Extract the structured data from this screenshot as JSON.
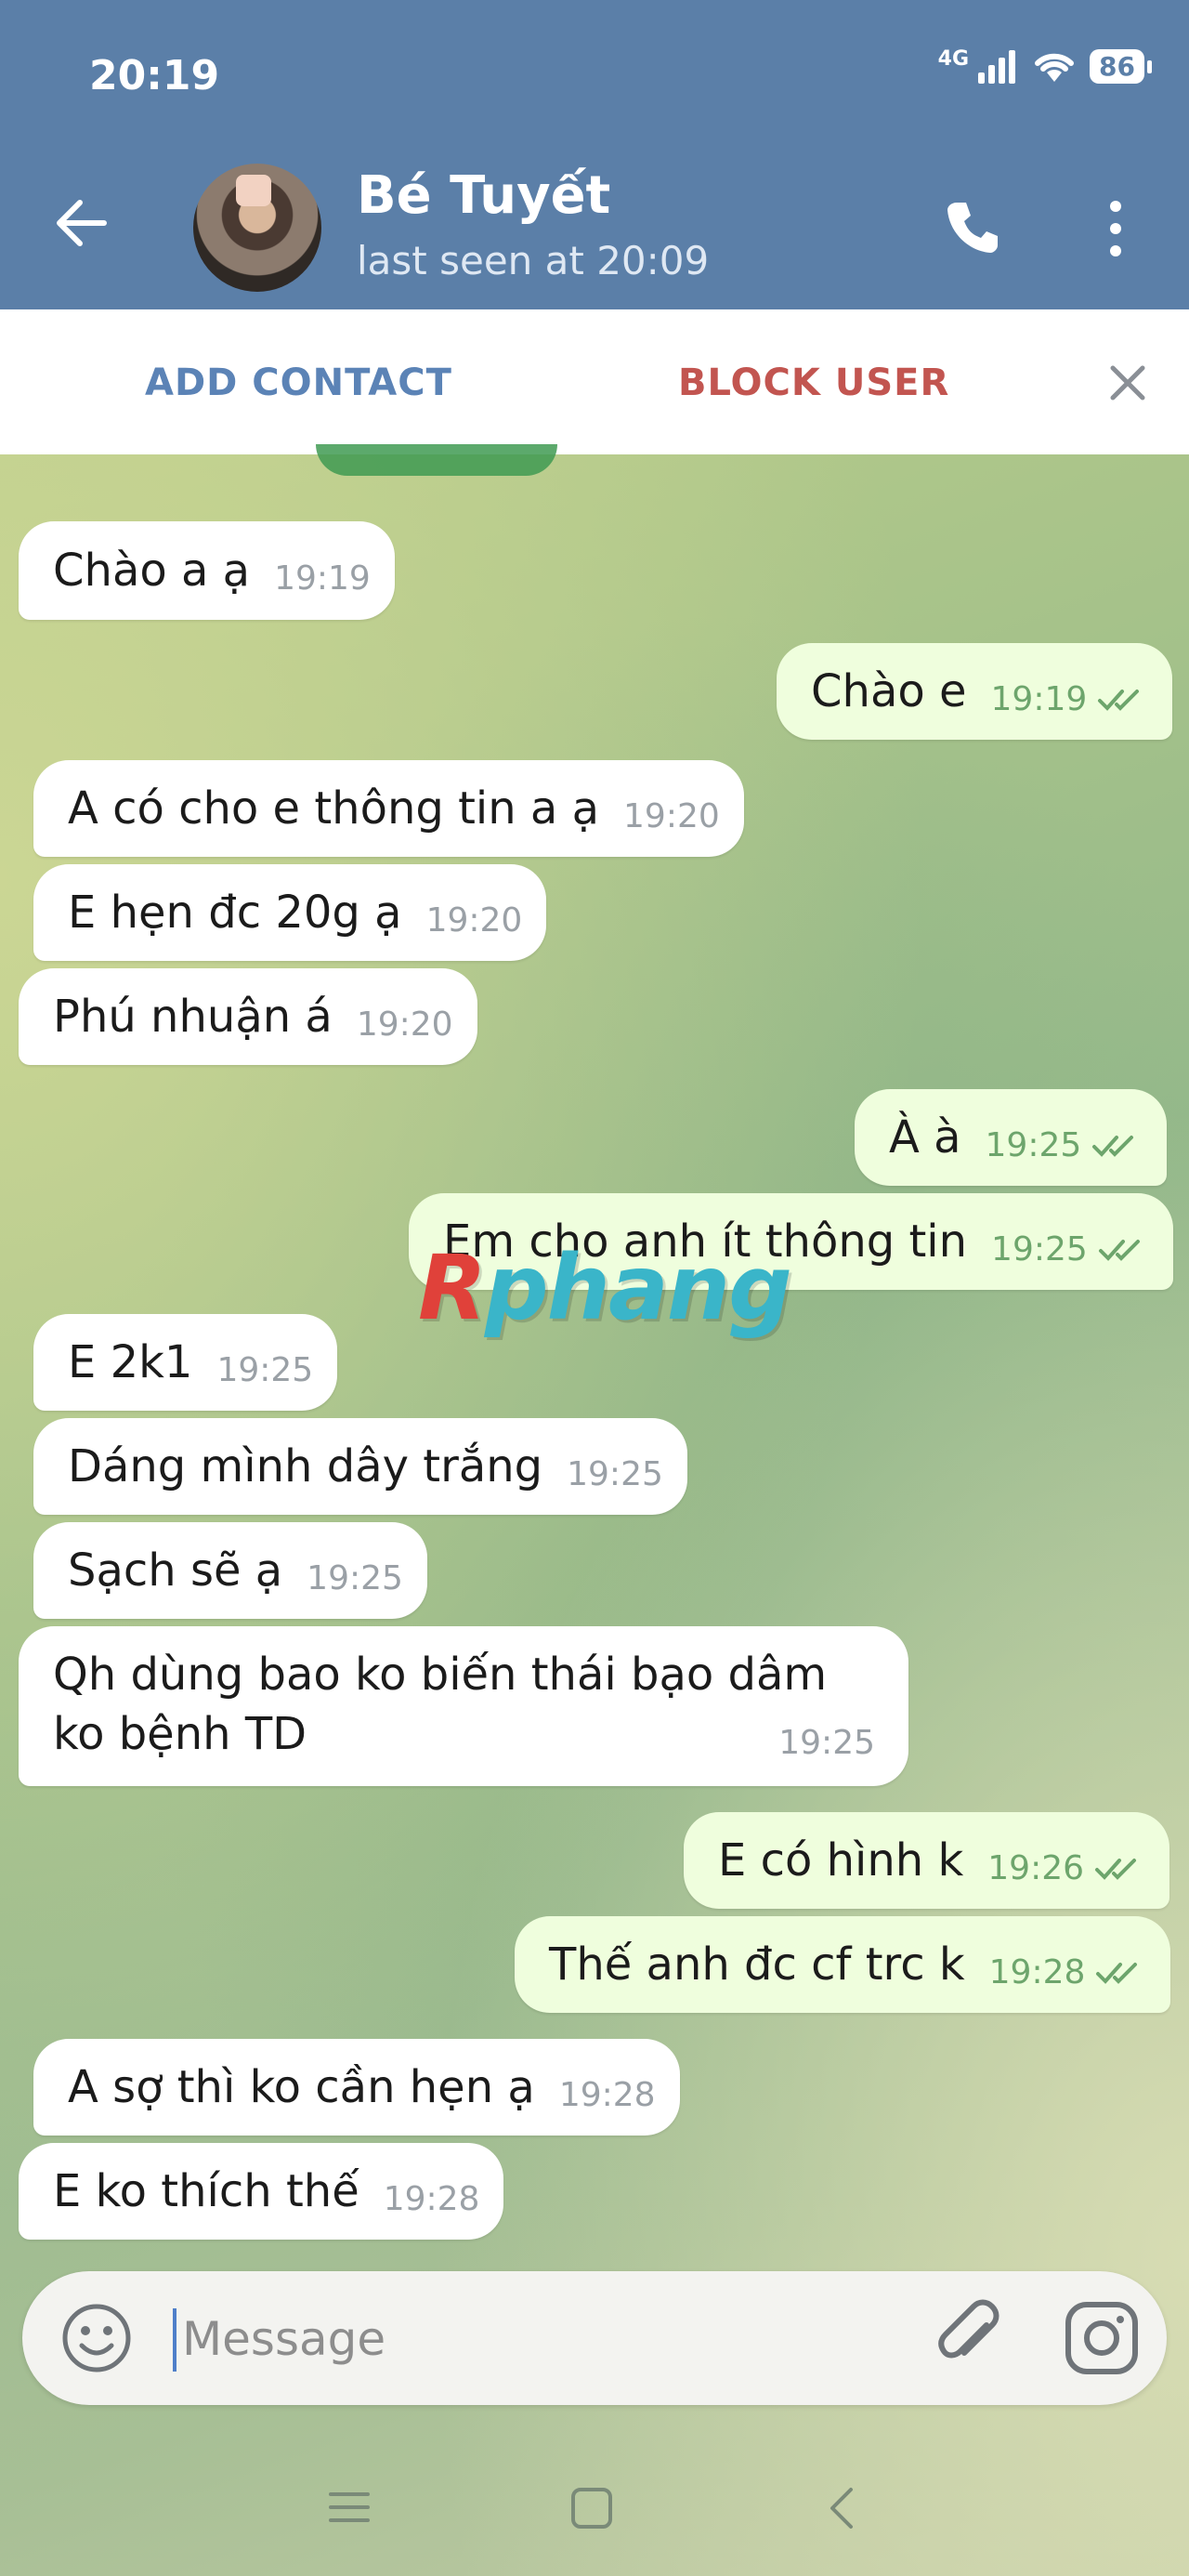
{
  "status_bar": {
    "time": "20:19",
    "network": "4G",
    "battery": "86"
  },
  "header": {
    "contact_name": "Bé Tuyết",
    "last_seen": "last seen at 20:09"
  },
  "action_bar": {
    "add_contact": "ADD CONTACT",
    "block_user": "BLOCK USER"
  },
  "messages": [
    {
      "side": "in",
      "text": "Chào a ạ",
      "time": "19:19"
    },
    {
      "side": "out",
      "text": "Chào e",
      "time": "19:19"
    },
    {
      "side": "in",
      "text": "A có cho e thông tin a ạ",
      "time": "19:20"
    },
    {
      "side": "in",
      "text": "E hẹn đc 20g ạ",
      "time": "19:20"
    },
    {
      "side": "in",
      "text": "Phú nhuận á",
      "time": "19:20"
    },
    {
      "side": "out",
      "text": "À à",
      "time": "19:25"
    },
    {
      "side": "out",
      "text": "Em cho anh ít thông tin",
      "time": "19:25"
    },
    {
      "side": "in",
      "text": "E 2k1",
      "time": "19:25"
    },
    {
      "side": "in",
      "text": "Dáng mình dây trắng",
      "time": "19:25"
    },
    {
      "side": "in",
      "text": "Sạch sẽ ạ",
      "time": "19:25"
    },
    {
      "side": "in",
      "text": "Qh dùng bao ko biến thái bạo dâm ko bệnh TD",
      "time": "19:25"
    },
    {
      "side": "out",
      "text": "E có hình k",
      "time": "19:26"
    },
    {
      "side": "out",
      "text": "Thế anh đc cf trc k",
      "time": "19:28"
    },
    {
      "side": "in",
      "text": "A sợ thì ko cần hẹn ạ",
      "time": "19:28"
    },
    {
      "side": "in",
      "text": "E ko thích thế",
      "time": "19:28"
    }
  ],
  "watermark": {
    "prefix": "R",
    "rest": "phang"
  },
  "input": {
    "placeholder": "Message"
  },
  "colors": {
    "header": "#5b7fa8",
    "incoming_bubble": "#ffffff",
    "outgoing_bubble": "#effedd",
    "read_ticks": "#6da56c",
    "block_user": "#c25550",
    "add_contact": "#5b83b6"
  },
  "icons": [
    "back-arrow-icon",
    "phone-icon",
    "more-vertical-icon",
    "close-icon",
    "emoji-icon",
    "attach-icon",
    "instagram-icon",
    "nav-menu-icon",
    "nav-home-icon",
    "nav-back-icon"
  ]
}
